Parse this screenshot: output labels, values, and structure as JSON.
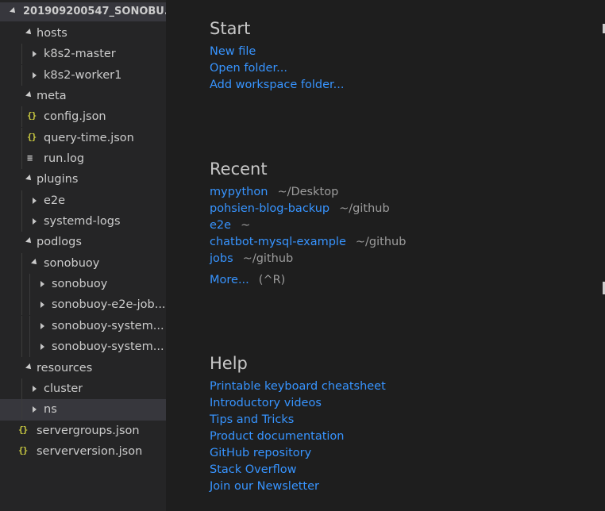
{
  "explorer": {
    "folder_name": "201909200547_SONOBU...",
    "tree": [
      {
        "label": "hosts",
        "depth": 1,
        "kind": "folder",
        "open": true
      },
      {
        "label": "k8s2-master",
        "depth": 2,
        "kind": "folder",
        "open": false
      },
      {
        "label": "k8s2-worker1",
        "depth": 2,
        "kind": "folder",
        "open": false
      },
      {
        "label": "meta",
        "depth": 1,
        "kind": "folder",
        "open": true
      },
      {
        "label": "config.json",
        "depth": 2,
        "kind": "json"
      },
      {
        "label": "query-time.json",
        "depth": 2,
        "kind": "json"
      },
      {
        "label": "run.log",
        "depth": 2,
        "kind": "log"
      },
      {
        "label": "plugins",
        "depth": 1,
        "kind": "folder",
        "open": true
      },
      {
        "label": "e2e",
        "depth": 2,
        "kind": "folder",
        "open": false
      },
      {
        "label": "systemd-logs",
        "depth": 2,
        "kind": "folder",
        "open": false
      },
      {
        "label": "podlogs",
        "depth": 1,
        "kind": "folder",
        "open": true
      },
      {
        "label": "sonobuoy",
        "depth": 2,
        "kind": "folder",
        "open": true
      },
      {
        "label": "sonobuoy",
        "depth": 3,
        "kind": "folder",
        "open": false
      },
      {
        "label": "sonobuoy-e2e-job...",
        "depth": 3,
        "kind": "folder",
        "open": false
      },
      {
        "label": "sonobuoy-system...",
        "depth": 3,
        "kind": "folder",
        "open": false
      },
      {
        "label": "sonobuoy-system...",
        "depth": 3,
        "kind": "folder",
        "open": false
      },
      {
        "label": "resources",
        "depth": 1,
        "kind": "folder",
        "open": true
      },
      {
        "label": "cluster",
        "depth": 2,
        "kind": "folder",
        "open": false
      },
      {
        "label": "ns",
        "depth": 2,
        "kind": "folder",
        "open": false,
        "selected": true
      },
      {
        "label": "servergroups.json",
        "depth": 1,
        "kind": "json"
      },
      {
        "label": "serverversion.json",
        "depth": 1,
        "kind": "json"
      }
    ]
  },
  "icons": {
    "json": "{}",
    "log": "≡"
  },
  "welcome": {
    "start": {
      "title": "Start",
      "links": [
        "New file",
        "Open folder...",
        "Add workspace folder..."
      ]
    },
    "recent": {
      "title": "Recent",
      "items": [
        {
          "name": "mypython",
          "path": "~/Desktop"
        },
        {
          "name": "pohsien-blog-backup",
          "path": "~/github"
        },
        {
          "name": "e2e",
          "path": "~"
        },
        {
          "name": "chatbot-mysql-example",
          "path": "~/github"
        },
        {
          "name": "jobs",
          "path": "~/github"
        }
      ],
      "more_label": "More...",
      "more_shortcut": "(^R)"
    },
    "help": {
      "title": "Help",
      "links": [
        "Printable keyboard cheatsheet",
        "Introductory videos",
        "Tips and Tricks",
        "Product documentation",
        "GitHub repository",
        "Stack Overflow",
        "Join our Newsletter"
      ]
    }
  },
  "colors": {
    "editor_bg": "#1e1e1e",
    "sidebar_bg": "#252526",
    "selection_bg": "#37373d",
    "link": "#3794ff",
    "json_icon": "#cbcb41"
  }
}
